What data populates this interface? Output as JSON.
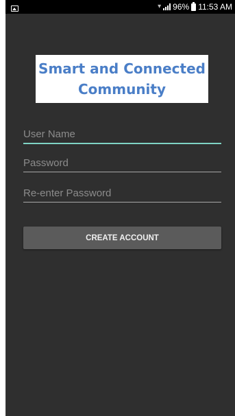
{
  "status_bar": {
    "battery": "96%",
    "time": "11:53 AM"
  },
  "logo": {
    "line1": "Smart and Connected",
    "line2": "Community"
  },
  "form": {
    "username_placeholder": "User Name",
    "password_placeholder": "Password",
    "reenter_placeholder": "Re-enter Password",
    "create_button": "CREATE ACCOUNT"
  },
  "colors": {
    "background": "#2f2f2f",
    "accent": "#7fd3c4",
    "logo_text": "#4a7ec7",
    "button": "#5b5b5b"
  },
  "icons": [
    "image-notification-icon",
    "wifi-icon",
    "signal-icon",
    "battery-icon"
  ]
}
